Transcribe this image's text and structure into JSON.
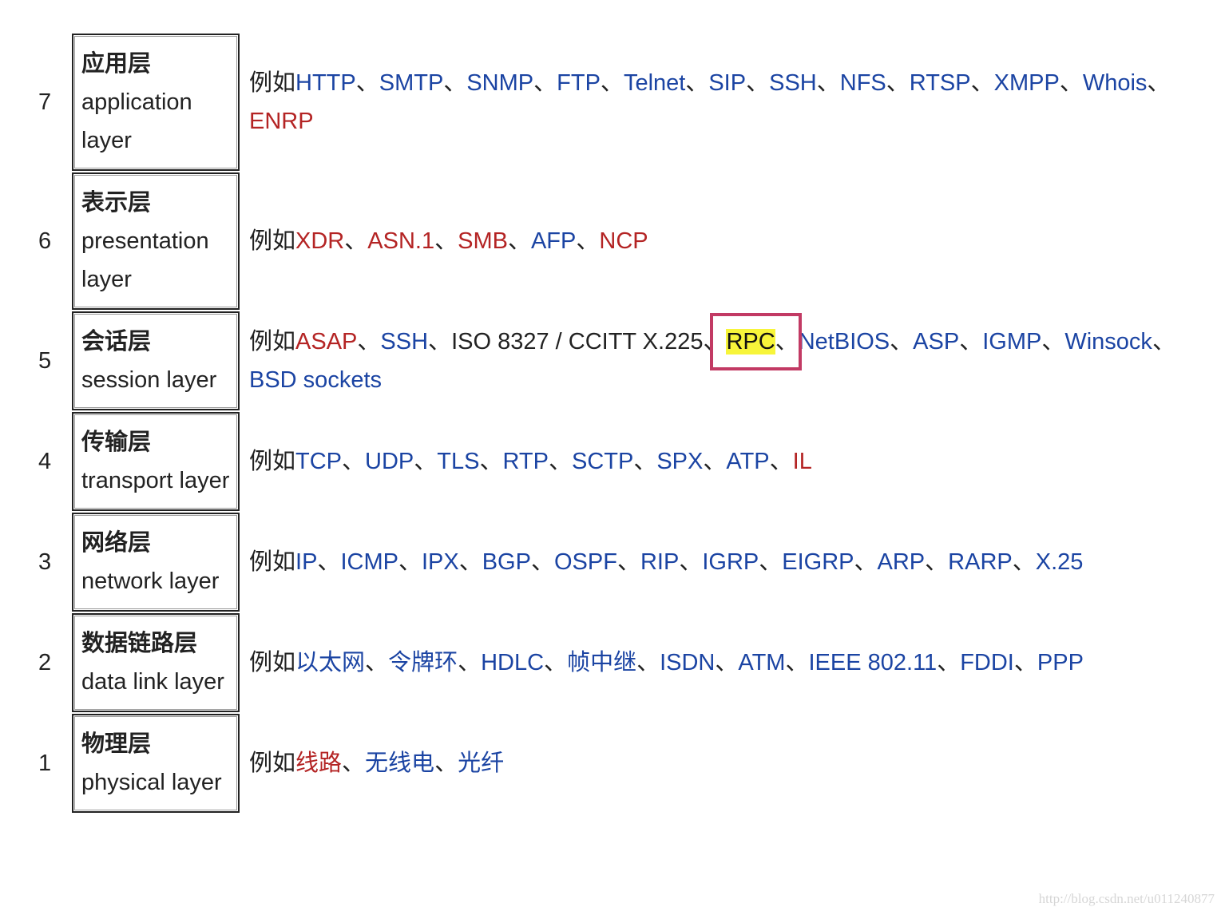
{
  "prefix": "例如",
  "separator": "、",
  "colors": {
    "link": "#1b44a3",
    "red_link": "#b42424",
    "highlight": "#f7f53a",
    "annotation_box": "#c23a64"
  },
  "layers": [
    {
      "number": "7",
      "name_cn": "应用层",
      "name_en": "application layer",
      "protocols": [
        {
          "text": "HTTP",
          "type": "link"
        },
        {
          "text": "SMTP",
          "type": "link"
        },
        {
          "text": "SNMP",
          "type": "link"
        },
        {
          "text": "FTP",
          "type": "link"
        },
        {
          "text": "Telnet",
          "type": "link"
        },
        {
          "text": "SIP",
          "type": "link"
        },
        {
          "text": "SSH",
          "type": "link"
        },
        {
          "text": "NFS",
          "type": "link"
        },
        {
          "text": "RTSP",
          "type": "link"
        },
        {
          "text": "XMPP",
          "type": "link"
        },
        {
          "text": "Whois",
          "type": "link"
        },
        {
          "text": "ENRP",
          "type": "red"
        }
      ]
    },
    {
      "number": "6",
      "name_cn": "表示层",
      "name_en": "presentation layer",
      "protocols": [
        {
          "text": "XDR",
          "type": "red"
        },
        {
          "text": "ASN.1",
          "type": "red"
        },
        {
          "text": "SMB",
          "type": "red"
        },
        {
          "text": "AFP",
          "type": "link"
        },
        {
          "text": "NCP",
          "type": "red"
        }
      ]
    },
    {
      "number": "5",
      "name_cn": "会话层",
      "name_en": "session layer",
      "protocols": [
        {
          "text": "ASAP",
          "type": "red"
        },
        {
          "text": "SSH",
          "type": "link"
        },
        {
          "text": "ISO 8327 / CCITT X.225",
          "type": "plain"
        },
        {
          "text": "RPC",
          "type": "highlight"
        },
        {
          "text": "NetBIOS",
          "type": "link"
        },
        {
          "text": "ASP",
          "type": "link"
        },
        {
          "text": "IGMP",
          "type": "link"
        },
        {
          "text": "Winsock",
          "type": "link"
        },
        {
          "text": "BSD sockets",
          "type": "link"
        }
      ]
    },
    {
      "number": "4",
      "name_cn": "传输层",
      "name_en": "transport layer",
      "protocols": [
        {
          "text": "TCP",
          "type": "link"
        },
        {
          "text": "UDP",
          "type": "link"
        },
        {
          "text": "TLS",
          "type": "link"
        },
        {
          "text": "RTP",
          "type": "link"
        },
        {
          "text": "SCTP",
          "type": "link"
        },
        {
          "text": "SPX",
          "type": "link"
        },
        {
          "text": "ATP",
          "type": "link"
        },
        {
          "text": "IL",
          "type": "red"
        }
      ]
    },
    {
      "number": "3",
      "name_cn": "网络层",
      "name_en": "network layer",
      "protocols": [
        {
          "text": "IP",
          "type": "link"
        },
        {
          "text": "ICMP",
          "type": "link"
        },
        {
          "text": "IPX",
          "type": "link"
        },
        {
          "text": "BGP",
          "type": "link"
        },
        {
          "text": "OSPF",
          "type": "link"
        },
        {
          "text": "RIP",
          "type": "link"
        },
        {
          "text": "IGRP",
          "type": "link"
        },
        {
          "text": "EIGRP",
          "type": "link"
        },
        {
          "text": "ARP",
          "type": "link"
        },
        {
          "text": "RARP",
          "type": "link"
        },
        {
          "text": "X.25",
          "type": "link"
        }
      ]
    },
    {
      "number": "2",
      "name_cn": "数据链路层",
      "name_en": "data link layer",
      "protocols": [
        {
          "text": "以太网",
          "type": "link"
        },
        {
          "text": "令牌环",
          "type": "link"
        },
        {
          "text": "HDLC",
          "type": "link"
        },
        {
          "text": "帧中继",
          "type": "link"
        },
        {
          "text": "ISDN",
          "type": "link"
        },
        {
          "text": "ATM",
          "type": "link"
        },
        {
          "text": "IEEE 802.11",
          "type": "link"
        },
        {
          "text": "FDDI",
          "type": "link"
        },
        {
          "text": "PPP",
          "type": "link"
        }
      ]
    },
    {
      "number": "1",
      "name_cn": "物理层",
      "name_en": "physical layer",
      "protocols": [
        {
          "text": "线路",
          "type": "red"
        },
        {
          "text": "无线电",
          "type": "link"
        },
        {
          "text": "光纤",
          "type": "link"
        }
      ]
    }
  ],
  "watermark": "http://blog.csdn.net/u011240877"
}
